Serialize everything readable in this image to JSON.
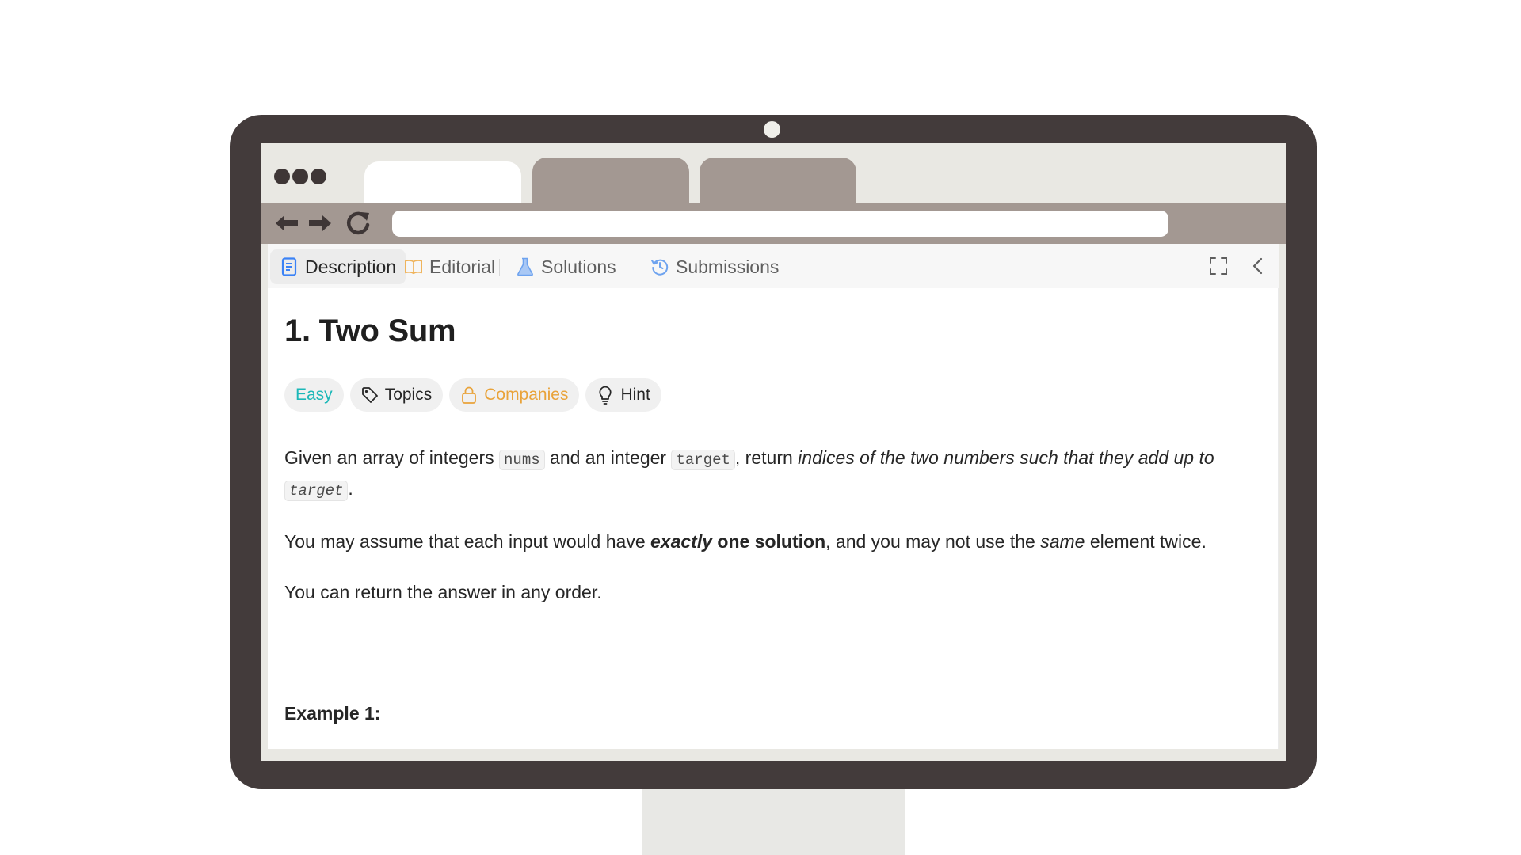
{
  "panel_tabs": [
    {
      "label": "Description",
      "icon": "document-icon",
      "active": true
    },
    {
      "label": "Editorial",
      "icon": "book-icon",
      "active": false
    },
    {
      "label": "Solutions",
      "icon": "flask-icon",
      "active": false
    },
    {
      "label": "Submissions",
      "icon": "history-icon",
      "active": false
    }
  ],
  "panel_actions": {
    "expand_icon": "fullscreen-icon",
    "collapse_icon": "chevron-left-icon"
  },
  "problem": {
    "title": "1. Two Sum",
    "badges": {
      "difficulty": "Easy",
      "topics": "Topics",
      "companies": "Companies",
      "hint": "Hint"
    },
    "paragraph1": {
      "t1": "Given an array of integers ",
      "code1": "nums",
      "t2": " and an integer ",
      "code2": "target",
      "t3": ", return ",
      "italic": "indices of the two numbers such that they add up to ",
      "code3": "target",
      "t4": "."
    },
    "paragraph2": {
      "t1": "You may assume that each input would have ",
      "bold_italic": "exactly",
      "bold": " one solution",
      "t2": ", and you may not use the ",
      "italic": "same",
      "t3": " element twice."
    },
    "paragraph3": "You can return the answer in any order.",
    "example_heading": "Example 1:"
  },
  "colors": {
    "bezel": "#433b3b",
    "tab_inactive": "#a39892",
    "easy": "#1cb8b8",
    "companies": "#e9a33a",
    "accent_blue": "#3b82f6"
  }
}
